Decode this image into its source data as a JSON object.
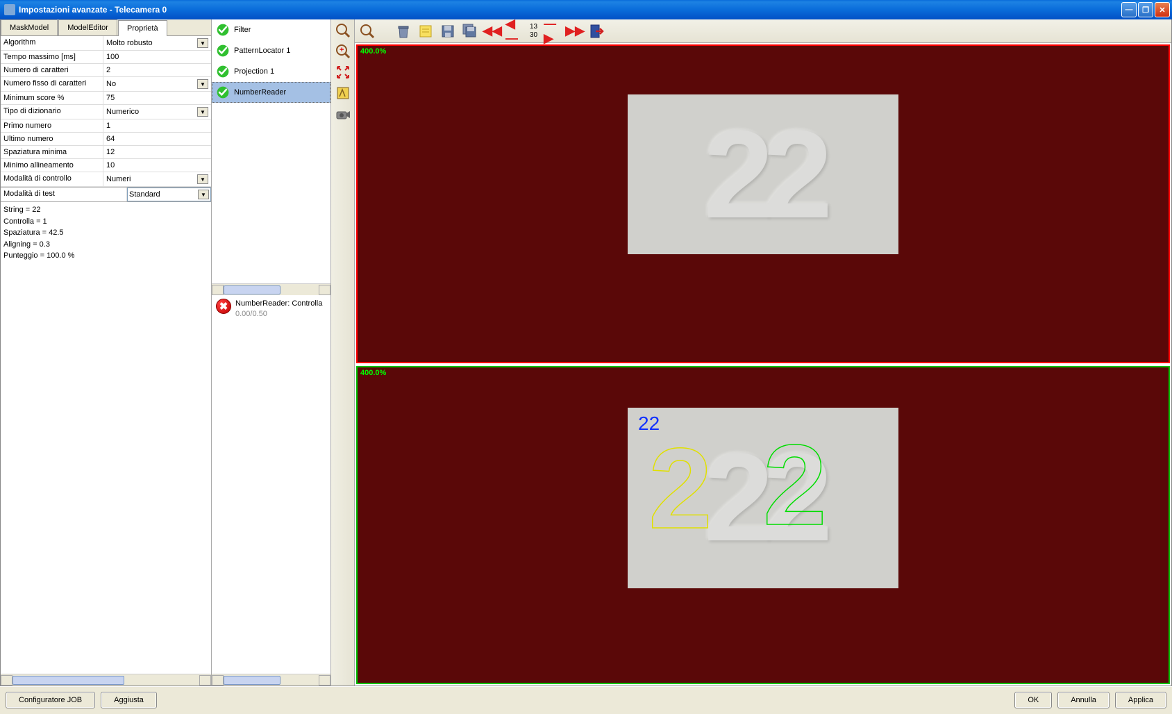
{
  "window": {
    "title": "Impostazioni avanzate - Telecamera 0"
  },
  "tabs": {
    "mask": "MaskModel",
    "model": "ModelEditor",
    "prop": "Proprietà"
  },
  "properties": [
    {
      "label": "Algorithm",
      "value": "Molto robusto",
      "dropdown": true
    },
    {
      "label": "Tempo massimo [ms]",
      "value": "100"
    },
    {
      "label": "Numero di caratteri",
      "value": "2"
    },
    {
      "label": "Numero fisso di caratteri",
      "value": "No",
      "dropdown": true
    },
    {
      "label": "Minimum score %",
      "value": "75"
    },
    {
      "label": "Tipo di dizionario",
      "value": "Numerico",
      "dropdown": true
    },
    {
      "label": "Primo numero",
      "value": "1"
    },
    {
      "label": "Ultimo numero",
      "value": "64"
    },
    {
      "label": "Spaziatura minima",
      "value": "12"
    },
    {
      "label": "Minimo allineamento",
      "value": "10"
    },
    {
      "label": "Modalità di controllo",
      "value": "Numeri",
      "dropdown": true
    }
  ],
  "test_mode": {
    "label": "Modalità di test",
    "value": "Standard"
  },
  "results": {
    "line1": "String = 22",
    "line2": "Controlla = 1",
    "line3": "Spaziatura = 42.5",
    "line4": "Aligning = 0.3",
    "line5": "Punteggio = 100.0 %"
  },
  "tree": {
    "items": [
      {
        "label": "Filter"
      },
      {
        "label": "PatternLocator 1"
      },
      {
        "label": "Projection 1"
      },
      {
        "label": "NumberReader",
        "selected": true
      }
    ]
  },
  "error": {
    "title": "NumberReader: Controlla",
    "sub": "0.00/0.50"
  },
  "toolbar": {
    "counter_top": "13",
    "counter_bottom": "30"
  },
  "viewport": {
    "zoom1": "400.0%",
    "zoom2": "400.0%",
    "overlay": "22",
    "digits": "22"
  },
  "buttons": {
    "cfg": "Configuratore JOB",
    "adj": "Aggiusta",
    "ok": "OK",
    "cancel": "Annulla",
    "apply": "Applica"
  }
}
